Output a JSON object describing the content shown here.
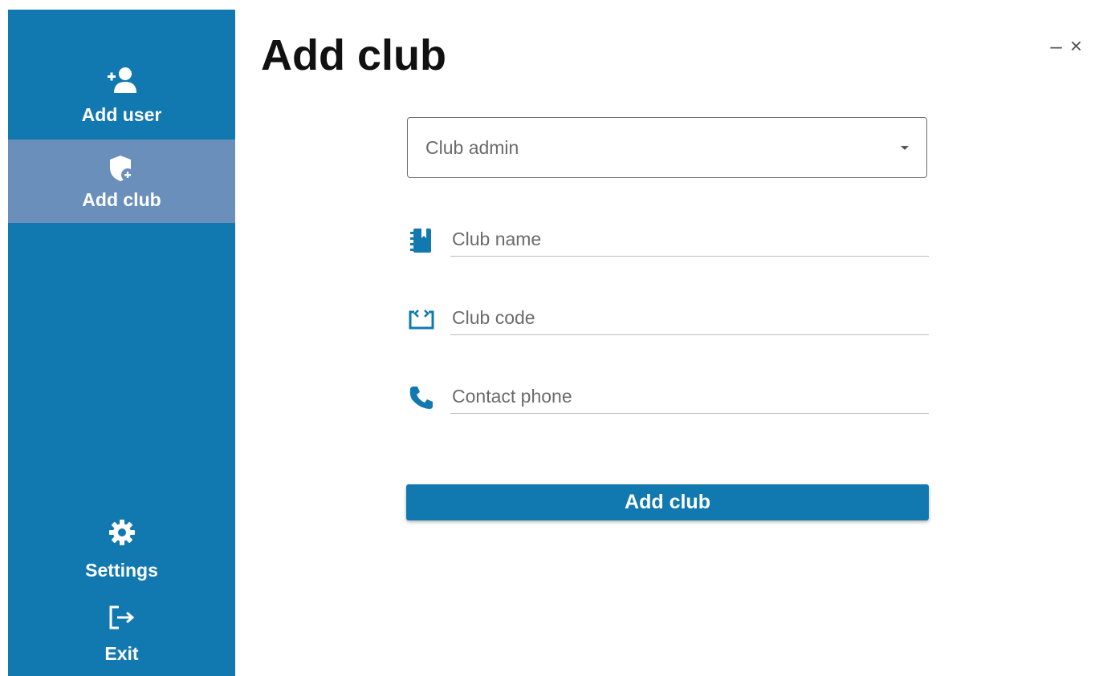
{
  "sidebar": {
    "items": [
      {
        "id": "add-user",
        "label": "Add user",
        "icon": "add-user-icon"
      },
      {
        "id": "add-club",
        "label": "Add club",
        "icon": "shield-plus-icon",
        "active": true
      },
      {
        "id": "settings",
        "label": "Settings",
        "icon": "gear-icon"
      },
      {
        "id": "exit",
        "label": "Exit",
        "icon": "logout-icon"
      }
    ]
  },
  "header": {
    "title": "Add club"
  },
  "window": {
    "minimize": "–",
    "close": "×"
  },
  "form": {
    "club_admin_placeholder": "Club admin",
    "club_name_placeholder": "Club name",
    "club_code_placeholder": "Club code",
    "contact_phone_placeholder": "Contact phone",
    "submit_label": "Add club"
  },
  "colors": {
    "accent": "#1279b0",
    "active_nav": "#6a8fbb"
  }
}
